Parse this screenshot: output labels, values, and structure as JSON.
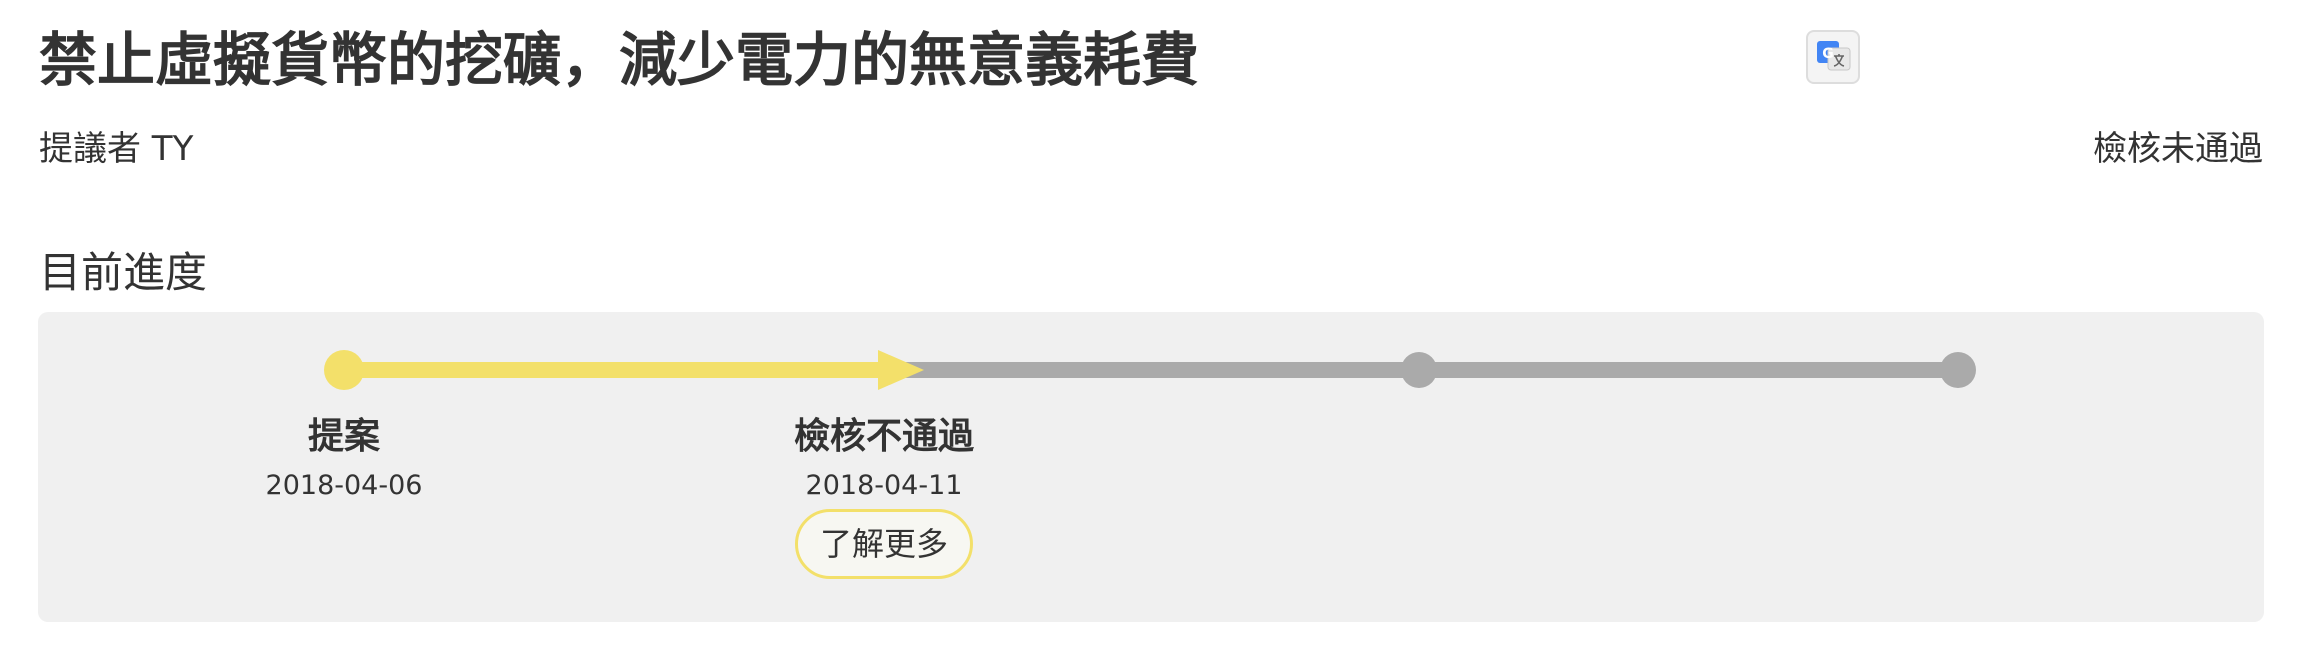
{
  "proposal": {
    "title": "禁止虛擬貨幣的挖礦，減少電力的無意義耗費",
    "proposer": "提議者 TY",
    "status": "檢核未通過"
  },
  "translate": {
    "icon": "google-translate-icon",
    "letter": "G"
  },
  "progress": {
    "section_title": "目前進度",
    "steps": [
      {
        "label": "提案",
        "date": "2018-04-06",
        "state": "done"
      },
      {
        "label": "檢核不通過",
        "date": "2018-04-11",
        "state": "current",
        "more_label": "了解更多"
      },
      {
        "label": "",
        "date": "",
        "state": "pending"
      },
      {
        "label": "",
        "date": "",
        "state": "pending"
      }
    ]
  },
  "colors": {
    "done": "#f3e06a",
    "pending": "#aaaaaa",
    "panel": "#f0f0f0",
    "text": "#333333"
  }
}
